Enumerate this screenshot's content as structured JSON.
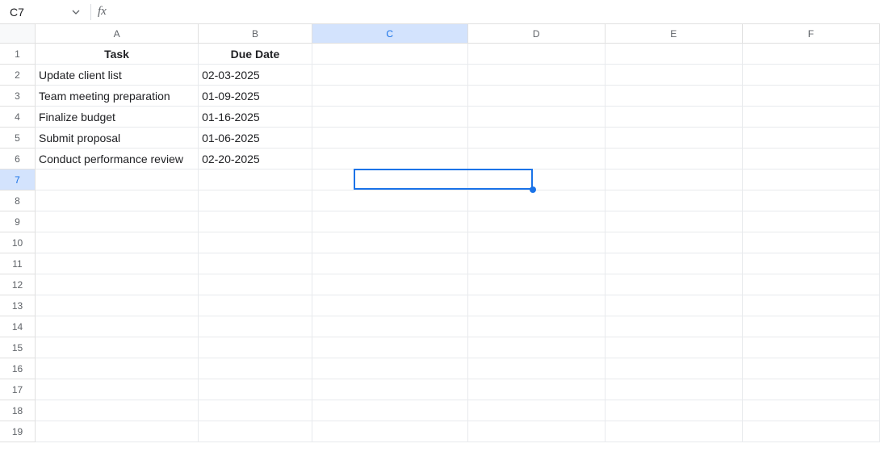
{
  "nameBox": {
    "value": "C7",
    "fxLabel": "fx",
    "formulaValue": ""
  },
  "columns": [
    "A",
    "B",
    "C",
    "D",
    "E",
    "F"
  ],
  "col_widths": {
    "A": 233,
    "B": 162,
    "C": 222,
    "D": 196,
    "E": 196,
    "F": 196
  },
  "row_count": 19,
  "selection": {
    "cell": "C7",
    "row": 7,
    "col": "C"
  },
  "headers": {
    "A1": "Task",
    "B1": "Due Date"
  },
  "rows": [
    {
      "task": "Update client list",
      "due": "02-03-2025"
    },
    {
      "task": "Team meeting preparation",
      "due": "01-09-2025"
    },
    {
      "task": "Finalize budget",
      "due": "01-16-2025"
    },
    {
      "task": "Submit proposal",
      "due": "01-06-2025"
    },
    {
      "task": "Conduct performance review",
      "due": "02-20-2025"
    }
  ],
  "chart_data": {
    "type": "table",
    "title": "",
    "columns": [
      "Task",
      "Due Date"
    ],
    "data": [
      [
        "Update client list",
        "02-03-2025"
      ],
      [
        "Team meeting preparation",
        "01-09-2025"
      ],
      [
        "Finalize budget",
        "01-16-2025"
      ],
      [
        "Submit proposal",
        "01-06-2025"
      ],
      [
        "Conduct performance review",
        "02-20-2025"
      ]
    ]
  }
}
